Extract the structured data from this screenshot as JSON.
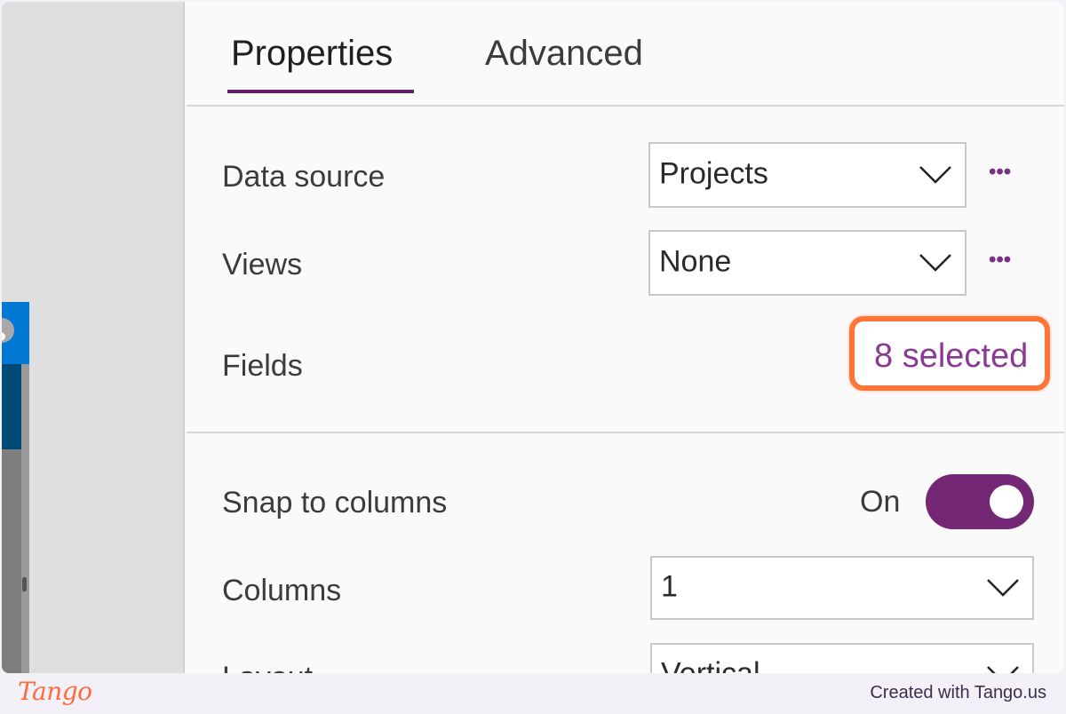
{
  "tabs": [
    {
      "label": "Properties",
      "active": true
    },
    {
      "label": "Advanced",
      "active": false
    }
  ],
  "properties": {
    "data_source": {
      "label": "Data source",
      "value": "Projects",
      "more_label": "•••"
    },
    "views": {
      "label": "Views",
      "value": "None",
      "more_label": "•••"
    },
    "fields": {
      "label": "Fields",
      "link_label": "8 selected"
    },
    "snap_to_columns": {
      "label": "Snap to columns",
      "state_label": "On",
      "enabled": true
    },
    "columns": {
      "label": "Columns",
      "value": "1"
    },
    "layout": {
      "label": "Layout",
      "value": "Vertical"
    }
  },
  "colors": {
    "accent": "#742774",
    "link": "#8a3a95",
    "highlight": "#ff7438"
  },
  "footer": {
    "logo": "Tango",
    "credit": "Created with Tango.us"
  }
}
